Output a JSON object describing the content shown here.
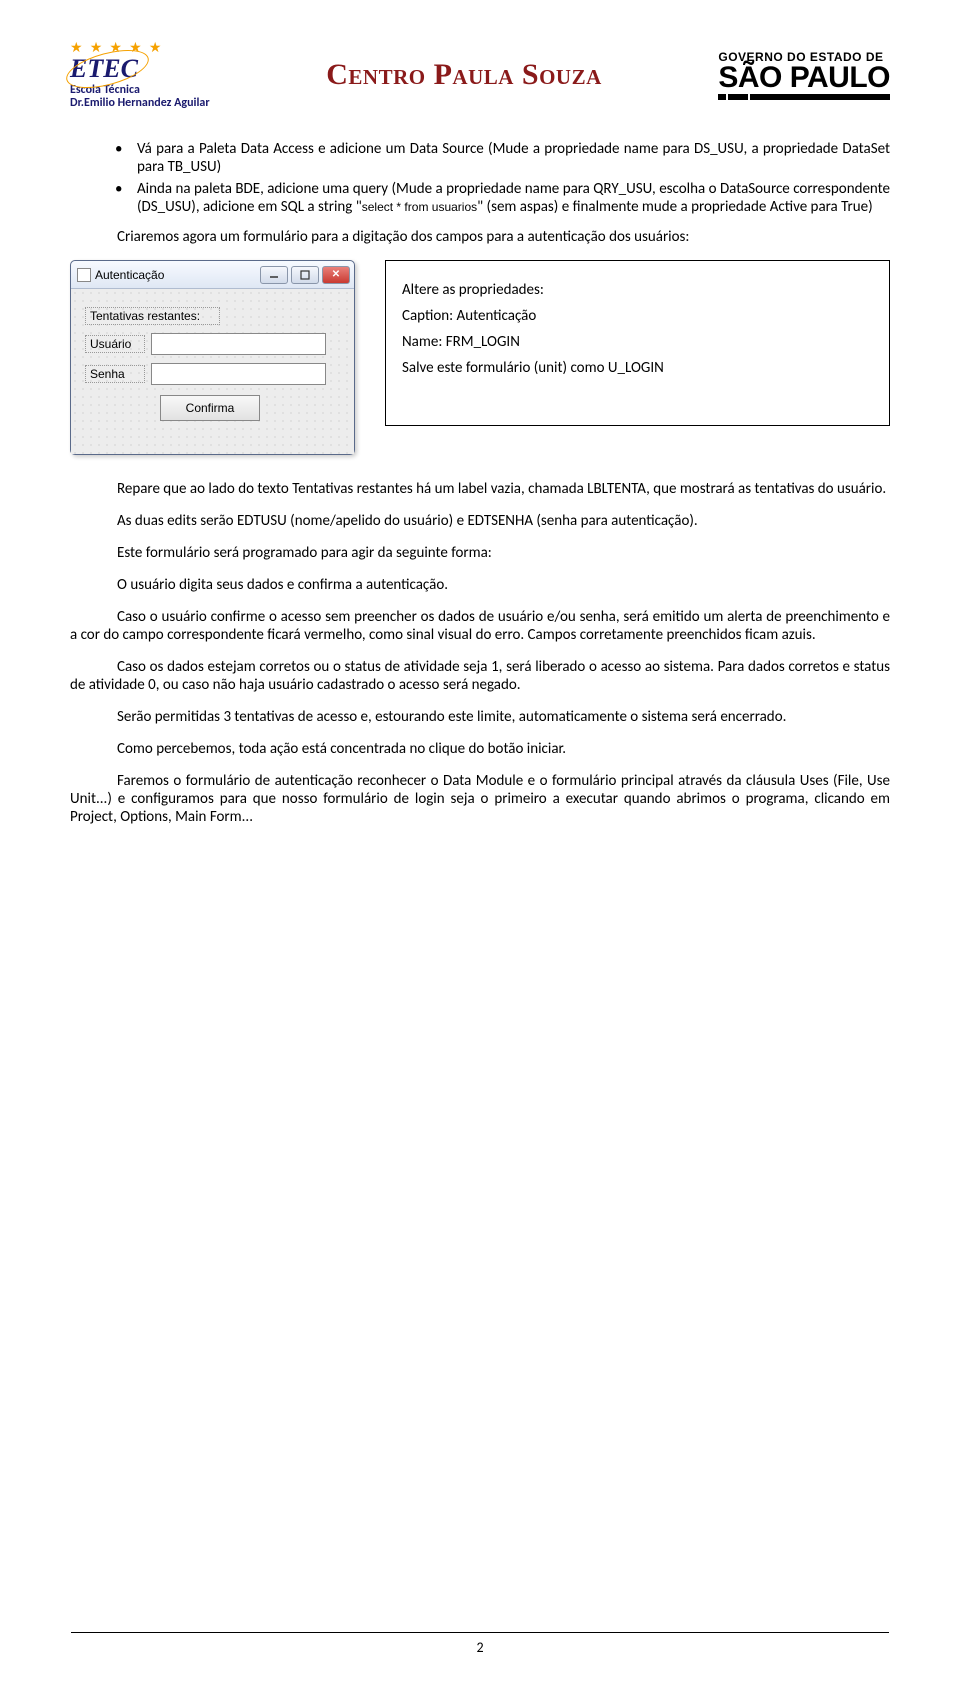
{
  "header": {
    "etec_stars": "★ ★ ★ ★ ★",
    "etec_logo": "ETEC",
    "etec_sub": "Escola Técnica",
    "etec_name": "Dr.Emilio Hernandez Aguilar",
    "cps": "Centro Paula Souza",
    "gov_top": "GOVERNO DO ESTADO DE",
    "gov_sp": "SÃO PAULO"
  },
  "bullets": [
    {
      "text": "Vá para a Paleta Data Access e adicione um Data Source (Mude a propriedade name para DS_USU, a propriedade DataSet para TB_USU)"
    },
    {
      "text_prefix": "Ainda na paleta BDE, adicione uma query (Mude a propriedade name para QRY_USU, escolha o DataSource correspondente (DS_USU), adicione em SQL a string \"",
      "code": "select * from usuarios",
      "text_suffix": "\" (sem aspas) e finalmente mude a propriedade Active para True)"
    }
  ],
  "intro_para": "Criaremos agora um formulário para a digitação dos campos para a autenticação dos usuários:",
  "form": {
    "title": "Autenticação",
    "label_tentativas": "Tentativas restantes:",
    "label_usuario": "Usuário",
    "label_senha": "Senha",
    "button_confirma": "Confirma"
  },
  "props_box": {
    "title": "Altere as propriedades:",
    "l1": "Caption: Autenticação",
    "l2": "Name: FRM_LOGIN",
    "l3": "Salve este formulário (unit) como U_LOGIN"
  },
  "paragraphs": [
    "Repare que ao lado do texto Tentativas restantes há um label vazia, chamada LBLTENTA, que mostrará as tentativas do usuário.",
    "As duas edits serão EDTUSU (nome/apelido do usuário) e EDTSENHA (senha para autenticação).",
    "Este formulário será programado para agir da seguinte forma:",
    "O usuário digita seus dados e confirma a autenticação.",
    "Caso o usuário confirme o acesso sem preencher os dados de usuário e/ou senha, será emitido um alerta de preenchimento e a cor do campo correspondente ficará vermelho, como sinal visual do erro. Campos corretamente preenchidos ficam azuis.",
    "Caso os dados estejam corretos ou o status de atividade seja 1, será liberado o acesso ao sistema. Para dados corretos e status de atividade 0, ou caso não haja usuário cadastrado o acesso será negado.",
    "Serão permitidas 3 tentativas de acesso e, estourando este limite, automaticamente o sistema será encerrado.",
    "Como percebemos, toda ação está concentrada no clique do botão iniciar.",
    "Faremos o formulário de autenticação reconhecer o Data Module e o formulário principal através da cláusula Uses (File, Use Unit...) e configuramos para que nosso formulário de login seja o primeiro a executar quando abrimos o programa, clicando em Project, Options, Main Form..."
  ],
  "page_number": "2"
}
